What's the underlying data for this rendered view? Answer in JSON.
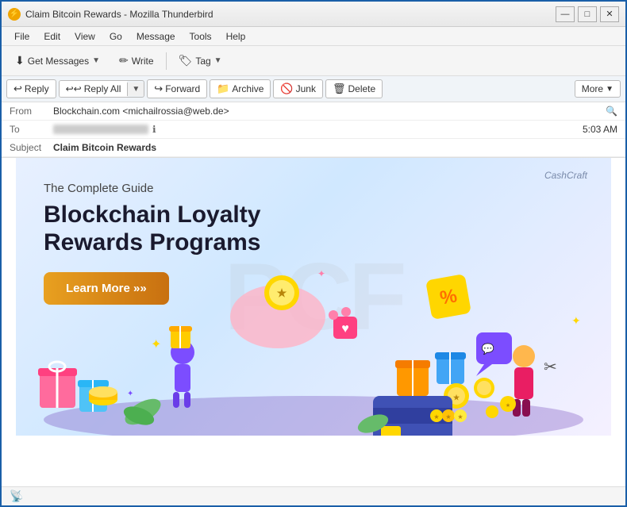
{
  "window": {
    "title": "Claim Bitcoin Rewards - Mozilla Thunderbird",
    "icon": "🌩"
  },
  "titlebar": {
    "minimize_label": "—",
    "maximize_label": "□",
    "close_label": "✕"
  },
  "menubar": {
    "items": [
      "File",
      "Edit",
      "View",
      "Go",
      "Message",
      "Tools",
      "Help"
    ]
  },
  "toolbar": {
    "get_messages_label": "Get Messages",
    "write_label": "Write",
    "tag_label": "Tag"
  },
  "email_toolbar": {
    "reply_label": "Reply",
    "reply_all_label": "Reply All",
    "forward_label": "Forward",
    "archive_label": "Archive",
    "junk_label": "Junk",
    "delete_label": "Delete",
    "more_label": "More"
  },
  "email_header": {
    "from_label": "From",
    "from_value": "Blockchain.com <michailrossia@web.de>",
    "to_label": "To",
    "subject_label": "Subject",
    "subject_value": "Claim Bitcoin Rewards",
    "time": "5:03 AM"
  },
  "banner": {
    "cashcraft_logo": "CashCraft",
    "subtitle": "The Complete Guide",
    "title": "Blockchain Loyalty Rewards Programs",
    "learn_more_label": "Learn More »»",
    "watermark": "PCF"
  },
  "statusbar": {
    "icon": "📡"
  }
}
